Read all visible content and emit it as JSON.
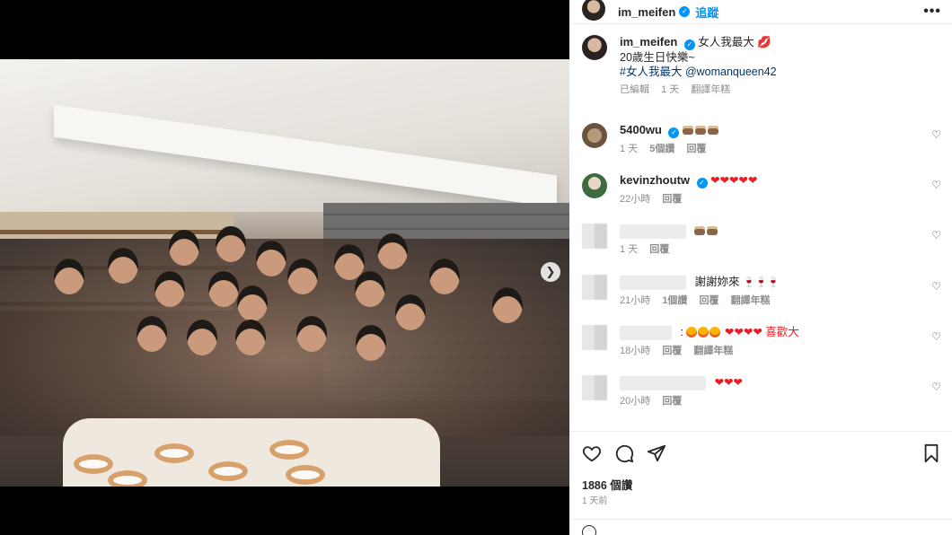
{
  "post": {
    "username": "im_meifen",
    "follow_label": "追蹤",
    "more_label": "•••"
  },
  "caption": {
    "username": "im_meifen",
    "line1": "女人我最大 💋",
    "line2": "20歲生日快樂~",
    "hashtag": "#女人我最大",
    "mention": "@womanqueen42",
    "edited": "已編輯",
    "time": "1 天",
    "translate": "翻譯年糕"
  },
  "comments": [
    {
      "username": "5400wu",
      "time": "1 天",
      "likes": "5個讚",
      "reply": "回覆"
    },
    {
      "username": "kevinzhoutw",
      "hearts": "❤❤❤❤❤",
      "time": "22小時",
      "reply": "回覆"
    },
    {
      "time": "1 天",
      "reply": "回覆"
    },
    {
      "text": "謝謝妳來",
      "time": "21小時",
      "likes": "1個讚",
      "reply": "回覆",
      "translate": "翻譯年糕"
    },
    {
      "text_suffix": "❤❤❤❤ 喜歡大",
      "time": "18小時",
      "reply": "回覆",
      "translate": "翻譯年糕"
    },
    {
      "hearts": "❤❤❤",
      "time": "20小時",
      "reply": "回覆"
    }
  ],
  "footer": {
    "like_count": "1886 個讚",
    "posted": "1 天前"
  },
  "icons": [
    "heart-icon",
    "comment-icon",
    "share-icon",
    "bookmark-icon",
    "verified-icon",
    "chevron-right-icon",
    "more-icon"
  ],
  "colors": {
    "accent": "#0095f6",
    "heart": "#ed1c24",
    "text": "#262626",
    "muted": "#8e8e8e"
  }
}
